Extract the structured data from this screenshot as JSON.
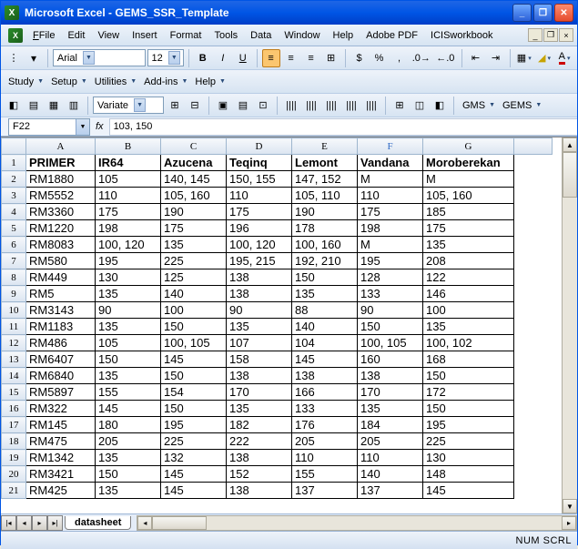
{
  "app": {
    "title": "Microsoft Excel - GEMS_SSR_Template"
  },
  "menus": [
    "File",
    "Edit",
    "View",
    "Insert",
    "Format",
    "Tools",
    "Data",
    "Window",
    "Help",
    "Adobe PDF",
    "ICISworkbook"
  ],
  "format_toolbar": {
    "font": "Arial",
    "size": "12"
  },
  "addin_toolbar": [
    "Study",
    "Setup",
    "Utilities",
    "Add-ins",
    "Help"
  ],
  "variate_toolbar": {
    "label": "Variate"
  },
  "gms_toolbar": {
    "a": "GMS",
    "b": "GEMS"
  },
  "formula_bar": {
    "name_box": "F22",
    "fx": "fx",
    "formula": "103, 150"
  },
  "columns": [
    "A",
    "B",
    "C",
    "D",
    "E",
    "F",
    "G"
  ],
  "header_row": [
    "PRIMER",
    "IR64",
    "Azucena",
    "Teqinq",
    "Lemont",
    "Vandana",
    "Moroberekan"
  ],
  "rows": [
    [
      "RM1880",
      "105",
      "140, 145",
      "150, 155",
      "147, 152",
      "M",
      "M"
    ],
    [
      "RM5552",
      "110",
      "105, 160",
      "110",
      "105, 110",
      "110",
      "105, 160"
    ],
    [
      "RM3360",
      "175",
      "190",
      "175",
      "190",
      "175",
      "185"
    ],
    [
      "RM1220",
      "198",
      "175",
      "196",
      "178",
      "198",
      "175"
    ],
    [
      "RM8083",
      "100, 120",
      "135",
      "100, 120",
      "100, 160",
      "M",
      "135"
    ],
    [
      "RM580",
      "195",
      "225",
      "195, 215",
      "192, 210",
      "195",
      "208"
    ],
    [
      "RM449",
      "130",
      "125",
      "138",
      "150",
      "128",
      "122"
    ],
    [
      "RM5",
      "135",
      "140",
      "138",
      "135",
      "133",
      "146"
    ],
    [
      "RM3143",
      "90",
      "100",
      "90",
      "88",
      "90",
      "100"
    ],
    [
      "RM1183",
      "135",
      "150",
      "135",
      "140",
      "150",
      "135"
    ],
    [
      "RM486",
      "105",
      "100, 105",
      "107",
      "104",
      "100, 105",
      "100, 102"
    ],
    [
      "RM6407",
      "150",
      "145",
      "158",
      "145",
      "160",
      "168"
    ],
    [
      "RM6840",
      "135",
      "150",
      "138",
      "138",
      "138",
      "150"
    ],
    [
      "RM5897",
      "155",
      "154",
      "170",
      "166",
      "170",
      "172"
    ],
    [
      "RM322",
      "145",
      "150",
      "135",
      "133",
      "135",
      "150"
    ],
    [
      "RM145",
      "180",
      "195",
      "182",
      "176",
      "184",
      "195"
    ],
    [
      "RM475",
      "205",
      "225",
      "222",
      "205",
      "205",
      "225"
    ],
    [
      "RM1342",
      "135",
      "132",
      "138",
      "110",
      "110",
      "130"
    ],
    [
      "RM3421",
      "150",
      "145",
      "152",
      "155",
      "140",
      "148"
    ],
    [
      "RM425",
      "135",
      "145",
      "138",
      "137",
      "137",
      "145"
    ]
  ],
  "sheet_tab": "datasheet",
  "status": {
    "indicators": "NUM SCRL"
  },
  "active_cell": {
    "ref": "F22"
  }
}
